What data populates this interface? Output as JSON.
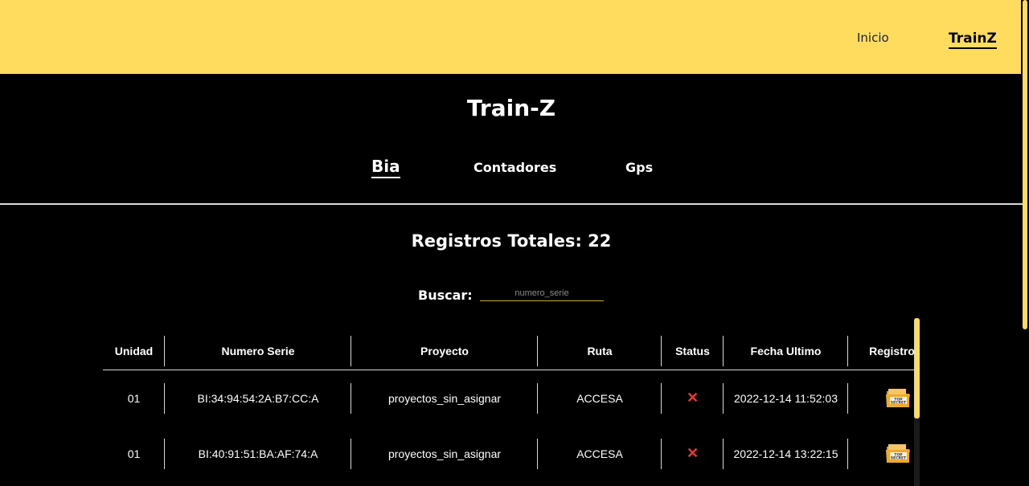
{
  "navbar": {
    "links": [
      {
        "label": "Inicio"
      },
      {
        "label": "TrainZ"
      }
    ],
    "corner_mark": "^"
  },
  "app": {
    "title": "Train-Z"
  },
  "tabs": [
    {
      "label": "Bia",
      "active": true
    },
    {
      "label": "Contadores",
      "active": false
    },
    {
      "label": "Gps",
      "active": false
    }
  ],
  "summary": {
    "total_label": "Registros Totales: 22"
  },
  "search": {
    "label": "Buscar:",
    "placeholder": "numero_serie",
    "value": ""
  },
  "table": {
    "columns": [
      "Unidad",
      "Numero Serie",
      "Proyecto",
      "Ruta",
      "Status",
      "Fecha Ultimo",
      "Registro C"
    ],
    "rows": [
      {
        "unidad": "01",
        "numero_serie": "BI:34:94:54:2A:B7:CC:A",
        "proyecto": "proyectos_sin_asignar",
        "ruta": "ACCESA",
        "status": "✕",
        "fecha": "2022-12-14 11:52:03",
        "registro_icon": "top-secret-folder-icon"
      },
      {
        "unidad": "01",
        "numero_serie": "BI:40:91:51:BA:AF:74:A",
        "proyecto": "proyectos_sin_asignar",
        "ruta": "ACCESA",
        "status": "✕",
        "fecha": "2022-12-14 13:22:15",
        "registro_icon": "top-secret-folder-icon"
      }
    ]
  },
  "colors": {
    "accent": "#ffdc5e",
    "background": "#000000",
    "status_error": "#e53935"
  }
}
